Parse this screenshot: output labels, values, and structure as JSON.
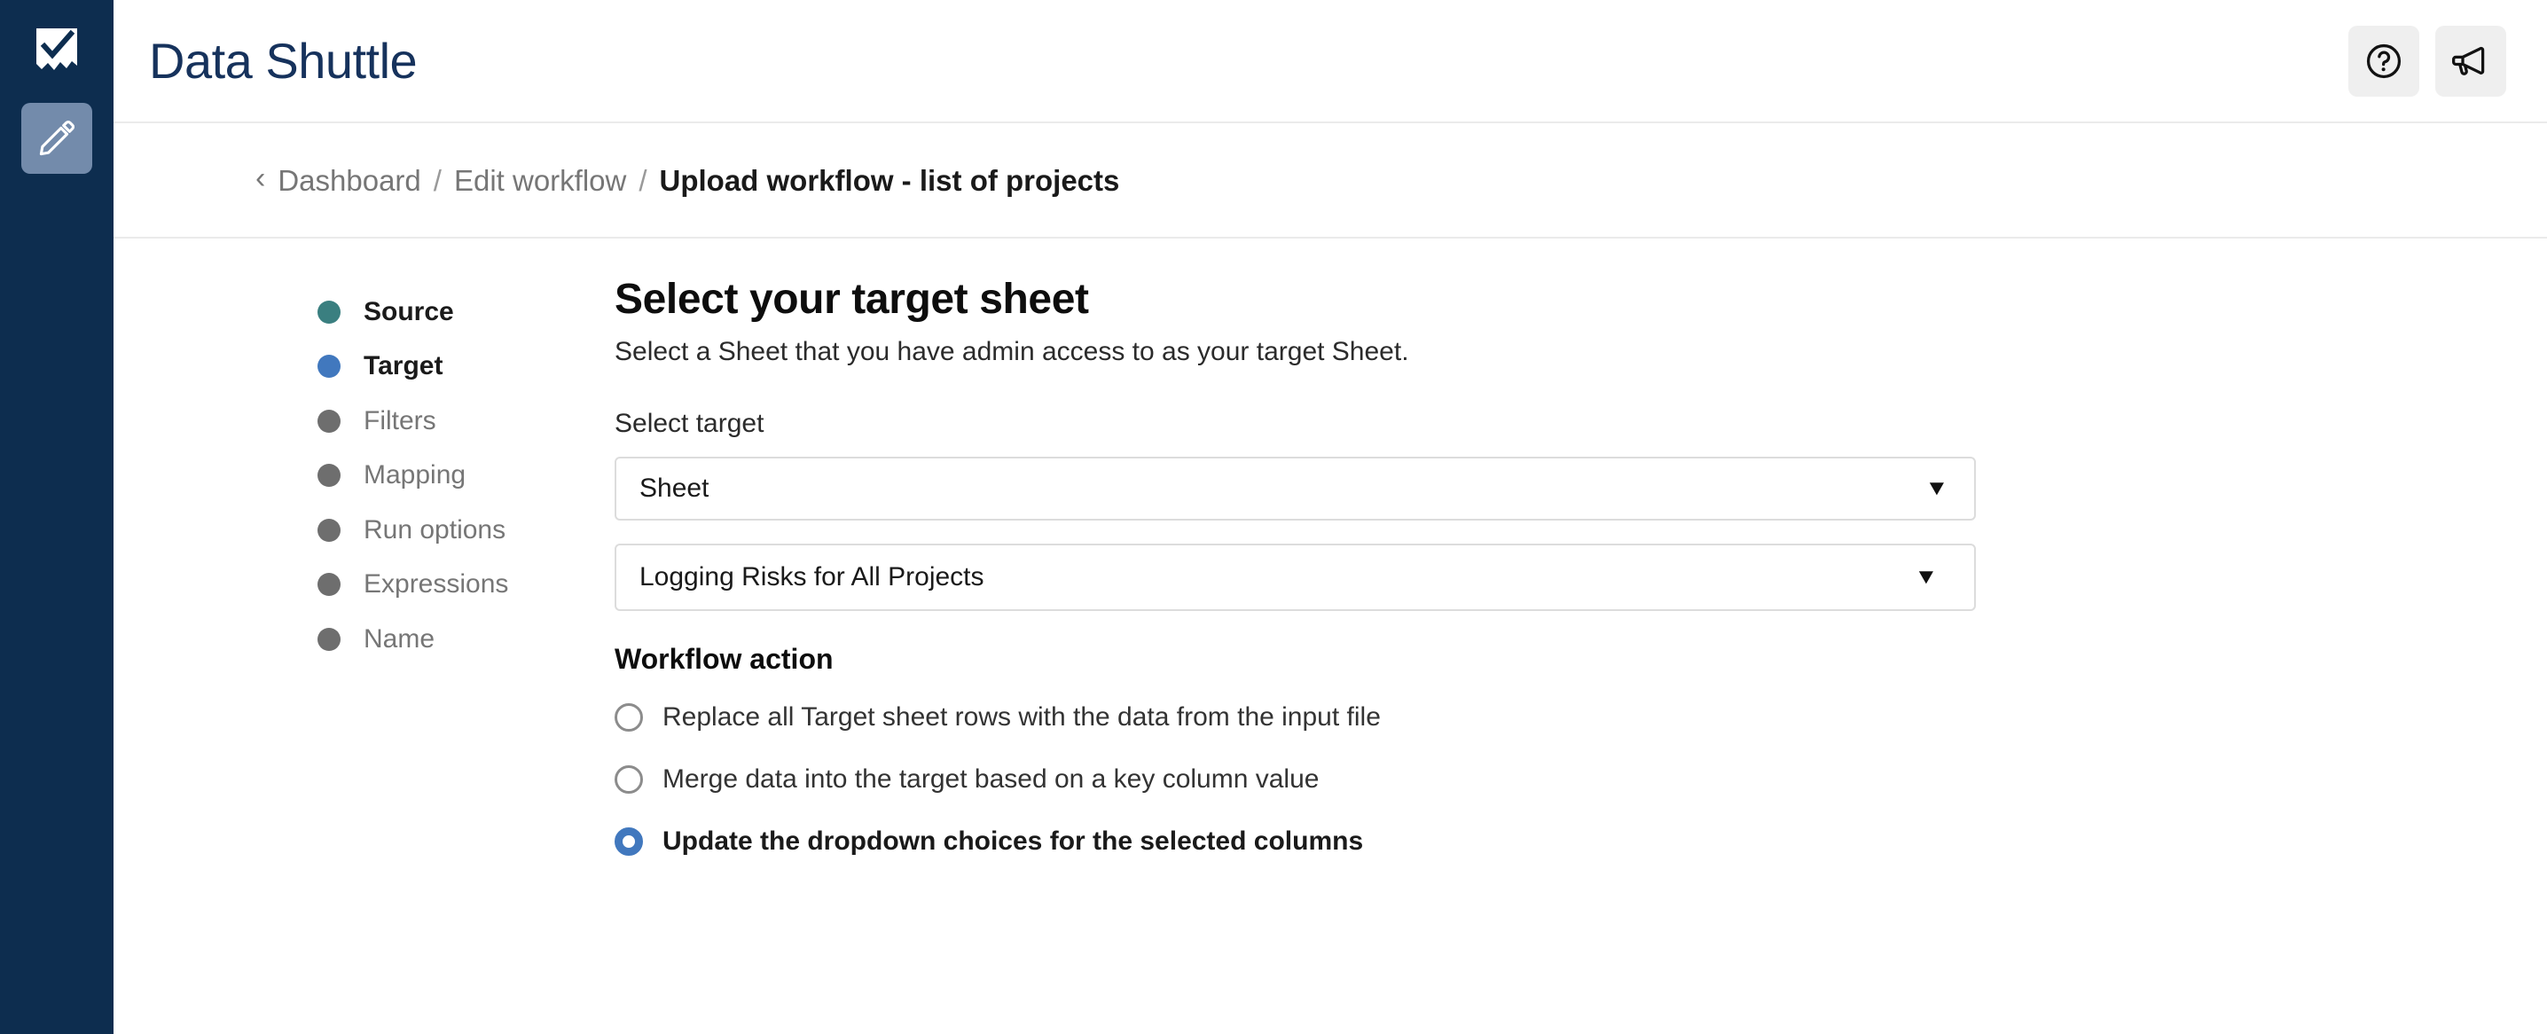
{
  "rail": {
    "logo_icon": "smartsheet-checkmark-flag-logo",
    "edit_button_icon": "pencil-icon",
    "background_color": "#0d2d4f",
    "button_color": "#738bab"
  },
  "header": {
    "title": "Data Shuttle",
    "title_color": "#16325c",
    "actions": [
      {
        "name": "help-button",
        "icon": "question-circle-icon"
      },
      {
        "name": "announcements-button",
        "icon": "megaphone-icon"
      }
    ]
  },
  "breadcrumb": {
    "back_icon": "chevron-left-icon",
    "separator": "/",
    "items": [
      {
        "label": "Dashboard",
        "current": false
      },
      {
        "label": "Edit workflow",
        "current": false
      },
      {
        "label": "Upload workflow - list of projects",
        "current": true
      }
    ]
  },
  "steps": [
    {
      "label": "Source",
      "state": "done"
    },
    {
      "label": "Target",
      "state": "active"
    },
    {
      "label": "Filters",
      "state": "pending"
    },
    {
      "label": "Mapping",
      "state": "pending"
    },
    {
      "label": "Run options",
      "state": "pending"
    },
    {
      "label": "Expressions",
      "state": "pending"
    },
    {
      "label": "Name",
      "state": "pending"
    }
  ],
  "step_colors": {
    "done": "#3a7f80",
    "active": "#4178be",
    "pending": "#6e6e6e"
  },
  "panel": {
    "title": "Select your target sheet",
    "subtitle": "Select a Sheet that you have admin access to as your target Sheet.",
    "select_target_label": "Select target",
    "target_type": {
      "value": "Sheet",
      "caret_icon": "chevron-down-icon"
    },
    "target_sheet": {
      "value": "Logging Risks for All Projects",
      "caret_icon": "chevron-down-icon"
    },
    "workflow_action": {
      "heading": "Workflow action",
      "options": [
        {
          "label": "Replace all Target sheet rows with the data from the input file",
          "selected": false
        },
        {
          "label": "Merge data into the target based on a key column value",
          "selected": false
        },
        {
          "label": "Update the dropdown choices for the selected columns",
          "selected": true
        }
      ]
    }
  }
}
